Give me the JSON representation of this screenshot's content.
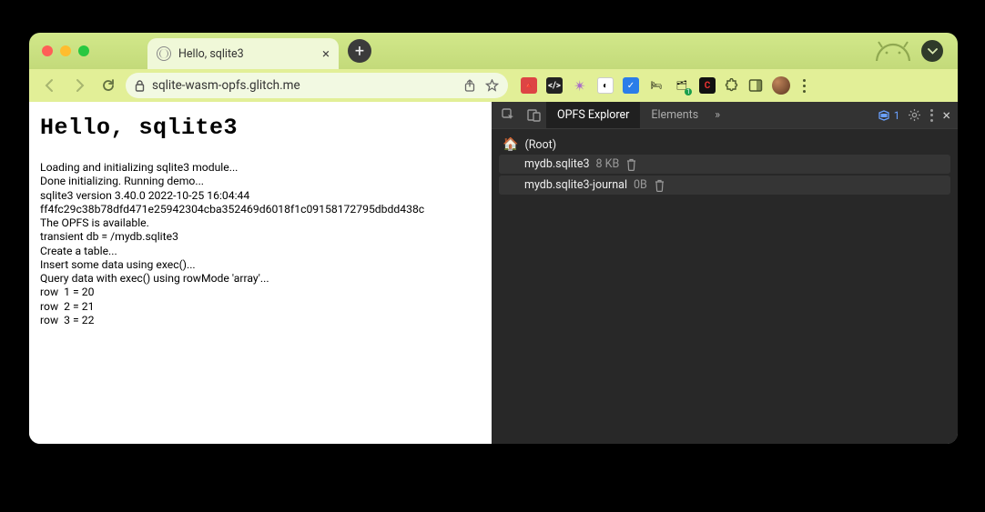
{
  "tab": {
    "title": "Hello, sqlite3"
  },
  "address": {
    "url": "sqlite-wasm-opfs.glitch.me"
  },
  "page": {
    "heading": "Hello, sqlite3",
    "output": "Loading and initializing sqlite3 module...\nDone initializing. Running demo...\nsqlite3 version 3.40.0 2022-10-25 16:04:44\nff4fc29c38b78dfd471e25942304cba352469d6018f1c09158172795dbdd438c\nThe OPFS is available.\ntransient db = /mydb.sqlite3\nCreate a table...\nInsert some data using exec()...\nQuery data with exec() using rowMode 'array'...\nrow  1 = 20\nrow  2 = 21\nrow  3 = 22"
  },
  "devtools": {
    "tabs": {
      "active": "OPFS Explorer",
      "other": "Elements",
      "more_icon": "»"
    },
    "issues_count": "1",
    "fs": {
      "root_label": "(Root)",
      "files": [
        {
          "name": "mydb.sqlite3",
          "size": "8 KB"
        },
        {
          "name": "mydb.sqlite3-journal",
          "size": "0B"
        }
      ]
    }
  }
}
